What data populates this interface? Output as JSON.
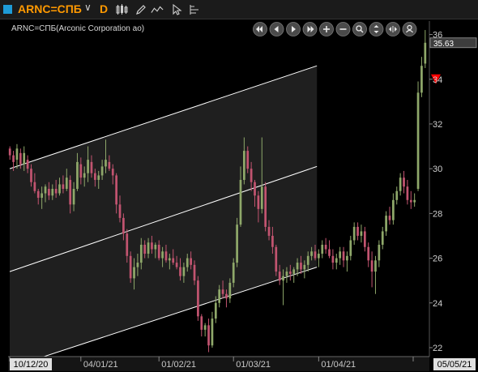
{
  "toolbar": {
    "symbol": "ARNC=СПБ",
    "period": "D",
    "accent": "#ff9900",
    "icons": [
      "candlestick-chart-icon",
      "pencil-draw-icon",
      "drawing-tools-icon",
      "cursor-icon",
      "chart-settings-icon"
    ]
  },
  "chart_data": {
    "type": "candlestick",
    "title": "ARNC=СПБ(Arconic Corporation ao)",
    "last_price_label": "35.63",
    "y_ticks": [
      22,
      24,
      26,
      28,
      30,
      32,
      34,
      36
    ],
    "ylim": [
      21.6,
      36.6
    ],
    "x_tick_labels": [
      "10/12/20",
      "04/01/21",
      "01/02/21",
      "01/03/21",
      "01/04/21",
      "05/05/21"
    ],
    "grid": false,
    "colors": {
      "up": "#8fa86a",
      "down": "#c25470",
      "background": "#000000",
      "channel": "#ffffff",
      "marker": "#ff0000"
    },
    "signal_marker": {
      "type": "sell-arrow",
      "price": 34.0,
      "bar_index": 120
    },
    "channel": {
      "start_index": 0,
      "end_index": 86,
      "upper": [
        30.0,
        34.6
      ],
      "middle": [
        25.4,
        30.1
      ],
      "lower": [
        21.1,
        25.6
      ]
    },
    "ohlc": [
      [
        30.9,
        31.0,
        30.4,
        30.6
      ],
      [
        30.6,
        30.8,
        29.9,
        30.3
      ],
      [
        30.4,
        31.1,
        30.0,
        30.9
      ],
      [
        30.7,
        30.9,
        30.0,
        30.2
      ],
      [
        30.2,
        31.0,
        29.9,
        30.7
      ],
      [
        30.4,
        30.6,
        29.8,
        30.0
      ],
      [
        30.0,
        30.2,
        29.2,
        29.4
      ],
      [
        29.4,
        29.8,
        28.9,
        29.0
      ],
      [
        29.0,
        29.1,
        28.4,
        28.7
      ],
      [
        28.7,
        29.2,
        28.2,
        28.9
      ],
      [
        28.9,
        29.3,
        28.5,
        29.2
      ],
      [
        29.1,
        29.4,
        28.6,
        28.8
      ],
      [
        28.8,
        29.3,
        28.6,
        29.1
      ],
      [
        29.1,
        29.5,
        28.7,
        28.9
      ],
      [
        28.9,
        29.6,
        28.8,
        29.3
      ],
      [
        29.3,
        29.7,
        28.9,
        29.1
      ],
      [
        29.1,
        30.0,
        29.0,
        29.6
      ],
      [
        29.5,
        29.7,
        28.0,
        28.4
      ],
      [
        28.4,
        29.4,
        28.1,
        29.1
      ],
      [
        29.1,
        30.7,
        29.0,
        30.3
      ],
      [
        30.2,
        30.5,
        29.3,
        29.6
      ],
      [
        29.6,
        30.1,
        29.2,
        29.8
      ],
      [
        29.8,
        31.0,
        29.4,
        30.4
      ],
      [
        30.3,
        30.6,
        29.6,
        29.8
      ],
      [
        29.8,
        30.0,
        29.2,
        29.5
      ],
      [
        29.5,
        29.9,
        29.1,
        29.7
      ],
      [
        29.7,
        30.4,
        29.5,
        30.1
      ],
      [
        30.1,
        31.3,
        29.8,
        30.4
      ],
      [
        30.3,
        30.6,
        29.9,
        30.0
      ],
      [
        30.0,
        30.2,
        29.3,
        29.7
      ],
      [
        29.7,
        29.8,
        28.0,
        28.4
      ],
      [
        28.4,
        28.8,
        27.6,
        27.8
      ],
      [
        27.8,
        28.0,
        26.8,
        27.1
      ],
      [
        27.1,
        27.3,
        25.8,
        26.1
      ],
      [
        26.1,
        26.3,
        24.9,
        25.1
      ],
      [
        25.1,
        26.0,
        24.6,
        25.6
      ],
      [
        25.6,
        26.2,
        25.2,
        25.8
      ],
      [
        25.8,
        26.9,
        25.5,
        26.6
      ],
      [
        26.6,
        26.8,
        26.0,
        26.2
      ],
      [
        26.2,
        26.9,
        26.0,
        26.7
      ],
      [
        26.7,
        27.0,
        26.2,
        26.4
      ],
      [
        26.4,
        26.7,
        26.0,
        26.6
      ],
      [
        26.6,
        26.8,
        25.9,
        26.0
      ],
      [
        26.0,
        26.5,
        25.6,
        26.3
      ],
      [
        26.3,
        26.6,
        25.8,
        25.9
      ],
      [
        25.9,
        26.2,
        25.5,
        26.0
      ],
      [
        26.0,
        26.4,
        25.7,
        25.8
      ],
      [
        25.8,
        26.1,
        25.5,
        25.6
      ],
      [
        25.6,
        26.0,
        25.0,
        25.2
      ],
      [
        25.2,
        25.8,
        24.9,
        25.6
      ],
      [
        25.6,
        26.2,
        25.4,
        26.0
      ],
      [
        26.0,
        26.3,
        25.5,
        25.7
      ],
      [
        25.7,
        25.9,
        24.8,
        25.0
      ],
      [
        25.0,
        25.2,
        23.2,
        23.4
      ],
      [
        23.4,
        23.5,
        22.5,
        22.8
      ],
      [
        22.8,
        23.1,
        22.5,
        23.0
      ],
      [
        23.0,
        23.3,
        21.8,
        22.1
      ],
      [
        22.1,
        23.6,
        22.0,
        23.3
      ],
      [
        23.3,
        24.3,
        23.1,
        24.0
      ],
      [
        24.0,
        24.8,
        23.8,
        24.6
      ],
      [
        24.6,
        25.0,
        24.2,
        24.4
      ],
      [
        24.4,
        24.6,
        23.8,
        24.2
      ],
      [
        24.2,
        25.1,
        24.0,
        24.9
      ],
      [
        24.9,
        26.0,
        24.7,
        25.8
      ],
      [
        25.8,
        27.8,
        25.6,
        27.5
      ],
      [
        27.5,
        30.1,
        27.4,
        29.5
      ],
      [
        29.5,
        31.4,
        29.3,
        30.8
      ],
      [
        30.8,
        31.0,
        29.8,
        30.0
      ],
      [
        30.0,
        30.3,
        29.0,
        29.4
      ],
      [
        29.4,
        29.5,
        28.3,
        28.8
      ],
      [
        28.8,
        29.0,
        27.6,
        28.2
      ],
      [
        28.2,
        31.4,
        28.0,
        29.2
      ],
      [
        29.2,
        29.4,
        27.2,
        27.4
      ],
      [
        27.4,
        27.7,
        26.8,
        27.0
      ],
      [
        27.0,
        27.4,
        26.2,
        26.5
      ],
      [
        26.5,
        26.6,
        25.2,
        25.4
      ],
      [
        25.4,
        25.7,
        24.8,
        25.0
      ],
      [
        25.0,
        25.5,
        23.9,
        25.2
      ],
      [
        25.2,
        25.6,
        24.9,
        25.4
      ],
      [
        25.4,
        25.7,
        25.0,
        25.3
      ],
      [
        25.3,
        25.6,
        24.9,
        25.5
      ],
      [
        25.5,
        26.0,
        25.2,
        25.8
      ],
      [
        25.8,
        26.1,
        25.3,
        25.5
      ],
      [
        25.5,
        25.9,
        25.1,
        25.7
      ],
      [
        25.7,
        26.3,
        25.4,
        26.1
      ],
      [
        26.1,
        26.5,
        25.9,
        26.3
      ],
      [
        26.3,
        26.6,
        25.9,
        26.0
      ],
      [
        26.0,
        26.4,
        25.6,
        26.2
      ],
      [
        26.2,
        26.8,
        26.0,
        26.6
      ],
      [
        26.6,
        26.9,
        26.2,
        26.4
      ],
      [
        26.4,
        26.8,
        26.0,
        26.1
      ],
      [
        26.1,
        26.4,
        25.5,
        25.8
      ],
      [
        25.8,
        26.2,
        25.5,
        26.0
      ],
      [
        26.0,
        26.5,
        25.7,
        26.3
      ],
      [
        26.3,
        26.5,
        25.6,
        25.9
      ],
      [
        25.9,
        26.3,
        25.4,
        26.1
      ],
      [
        26.1,
        27.0,
        25.9,
        26.8
      ],
      [
        26.8,
        27.6,
        26.6,
        27.4
      ],
      [
        27.4,
        27.6,
        26.8,
        27.0
      ],
      [
        27.0,
        27.5,
        26.7,
        27.2
      ],
      [
        27.2,
        27.4,
        26.3,
        26.5
      ],
      [
        26.5,
        26.7,
        25.6,
        25.9
      ],
      [
        25.9,
        26.3,
        24.7,
        25.4
      ],
      [
        25.4,
        26.1,
        24.4,
        25.9
      ],
      [
        25.9,
        26.8,
        25.6,
        26.6
      ],
      [
        26.6,
        27.4,
        26.4,
        27.2
      ],
      [
        27.2,
        28.1,
        27.0,
        27.9
      ],
      [
        27.9,
        28.3,
        27.5,
        27.7
      ],
      [
        27.7,
        28.9,
        27.5,
        28.6
      ],
      [
        28.6,
        29.2,
        28.4,
        29.0
      ],
      [
        29.0,
        29.8,
        28.8,
        29.6
      ],
      [
        29.6,
        29.9,
        28.9,
        29.2
      ],
      [
        29.2,
        29.5,
        28.4,
        28.6
      ],
      [
        28.6,
        29.0,
        28.2,
        28.5
      ],
      [
        28.5,
        28.9,
        28.3,
        28.6
      ],
      [
        29.1,
        33.9,
        29.0,
        33.4
      ],
      [
        33.4,
        35.0,
        33.2,
        34.6
      ],
      [
        34.7,
        36.2,
        34.5,
        35.63
      ]
    ]
  }
}
